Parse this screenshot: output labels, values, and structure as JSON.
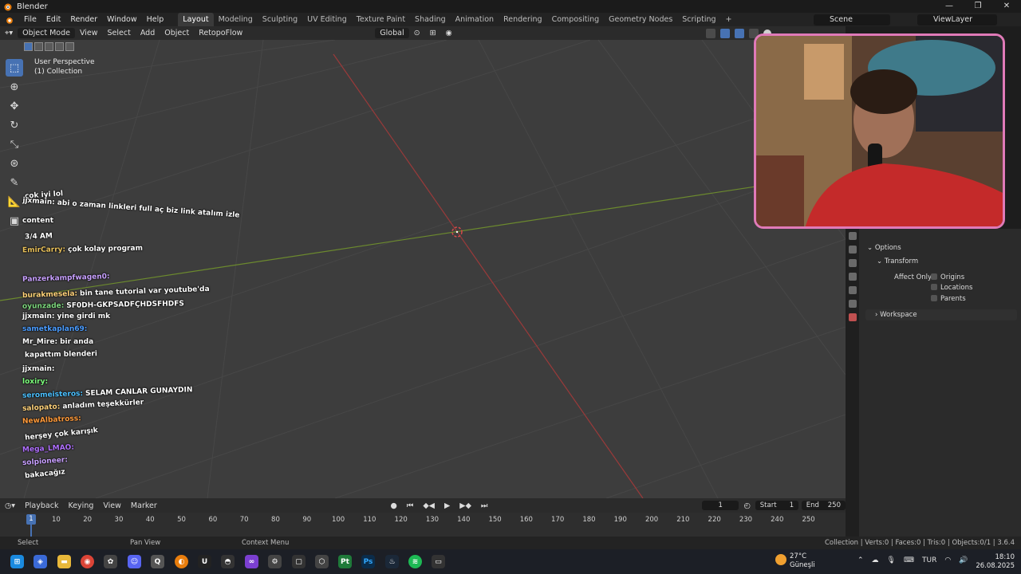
{
  "window": {
    "title": "Blender"
  },
  "menus": [
    "File",
    "Edit",
    "Render",
    "Window",
    "Help"
  ],
  "workspaces": [
    "Layout",
    "Modeling",
    "Sculpting",
    "UV Editing",
    "Texture Paint",
    "Shading",
    "Animation",
    "Rendering",
    "Compositing",
    "Geometry Nodes",
    "Scripting"
  ],
  "active_workspace": "Layout",
  "scene": "Scene",
  "view_layer": "ViewLayer",
  "viewport_header": {
    "mode": "Object Mode",
    "view": "View",
    "select": "Select",
    "add": "Add",
    "object": "Object",
    "addon": "RetopoFlow",
    "orientation": "Global"
  },
  "viewport": {
    "perspective": "User Perspective",
    "collection": "(1) Collection"
  },
  "chat": [
    {
      "user": "",
      "msg": "çok iyi lol",
      "color": "#c0304a"
    },
    {
      "user": "jjxmain:",
      "msg": "abi o zaman linkleri full aç biz link atalım izle",
      "color": "#ffffff"
    },
    {
      "user": "content",
      "msg": "",
      "color": "#ffffff"
    },
    {
      "user": "",
      "msg": "3/4 AM",
      "color": "#c0304a"
    },
    {
      "user": "EmirCarry:",
      "msg": "çok kolay program",
      "color": "#e8c05a"
    },
    {
      "user": "",
      "msg": "",
      "color": "#c0304a"
    },
    {
      "user": "Panzerkampfwagen0:",
      "msg": "",
      "color": "#c8a0ff"
    },
    {
      "user": "burakmesela:",
      "msg": "bin tane tutorial var youtube'da",
      "color": "#ffd27a"
    },
    {
      "user": "oyunzade:",
      "msg": "SF0DH-GKPSADFÇHDSFHDFS",
      "color": "#7cd67c"
    },
    {
      "user": "jjxmain:",
      "msg": "yine girdi mk",
      "color": "#ffffff"
    },
    {
      "user": "sametkaplan69:",
      "msg": "",
      "color": "#4a9cff"
    },
    {
      "user": "Mr_Mire:",
      "msg": "bir anda",
      "color": "#ffffff"
    },
    {
      "user": "",
      "msg": "kapattım blenderi",
      "color": "#c0304a"
    },
    {
      "user": "jjxmain:",
      "msg": "",
      "color": "#ffffff"
    },
    {
      "user": "loxiry:",
      "msg": "",
      "color": "#7cff7c"
    },
    {
      "user": "seromeisteros:",
      "msg": "SELAM CANLAR GUNAYDIN",
      "color": "#4ac0ff"
    },
    {
      "user": "salopato:",
      "msg": "anladım teşekkürler",
      "color": "#ffd27a"
    },
    {
      "user": "NewAlbatross:",
      "msg": "",
      "color": "#ff9a3a"
    },
    {
      "user": "",
      "msg": "herşey çok karışık",
      "color": "#c0304a"
    },
    {
      "user": "Mega_LMAO:",
      "msg": "",
      "color": "#b070ff"
    },
    {
      "user": "solpioneer:",
      "msg": "",
      "color": "#c8a0ff"
    },
    {
      "user": "",
      "msg": "bakacağız",
      "color": "#c0304a"
    }
  ],
  "properties": {
    "options": "Options",
    "transform": "Transform",
    "affect_only": "Affect Only",
    "origins": "Origins",
    "locations": "Locations",
    "parents": "Parents",
    "workspace": "Workspace"
  },
  "timeline": {
    "playback": "Playback",
    "keying": "Keying",
    "view": "View",
    "marker": "Marker",
    "current_frame": "1",
    "start_label": "Start",
    "start": "1",
    "end_label": "End",
    "end": "250",
    "ticks": [
      "10",
      "20",
      "30",
      "40",
      "50",
      "60",
      "70",
      "80",
      "90",
      "100",
      "110",
      "120",
      "130",
      "140",
      "150",
      "160",
      "170",
      "180",
      "190",
      "200",
      "210",
      "220",
      "230",
      "240",
      "250"
    ]
  },
  "statusbar": {
    "select": "Select",
    "pan": "Pan View",
    "context": "Context Menu",
    "stats": "Collection | Verts:0 | Faces:0 | Tris:0 | Objects:0/1 | 3.6.4"
  },
  "taskbar": {
    "temp": "27°C",
    "weather": "Güneşli",
    "lang": "TUR",
    "time": "18:10",
    "date": "26.08.2025"
  }
}
